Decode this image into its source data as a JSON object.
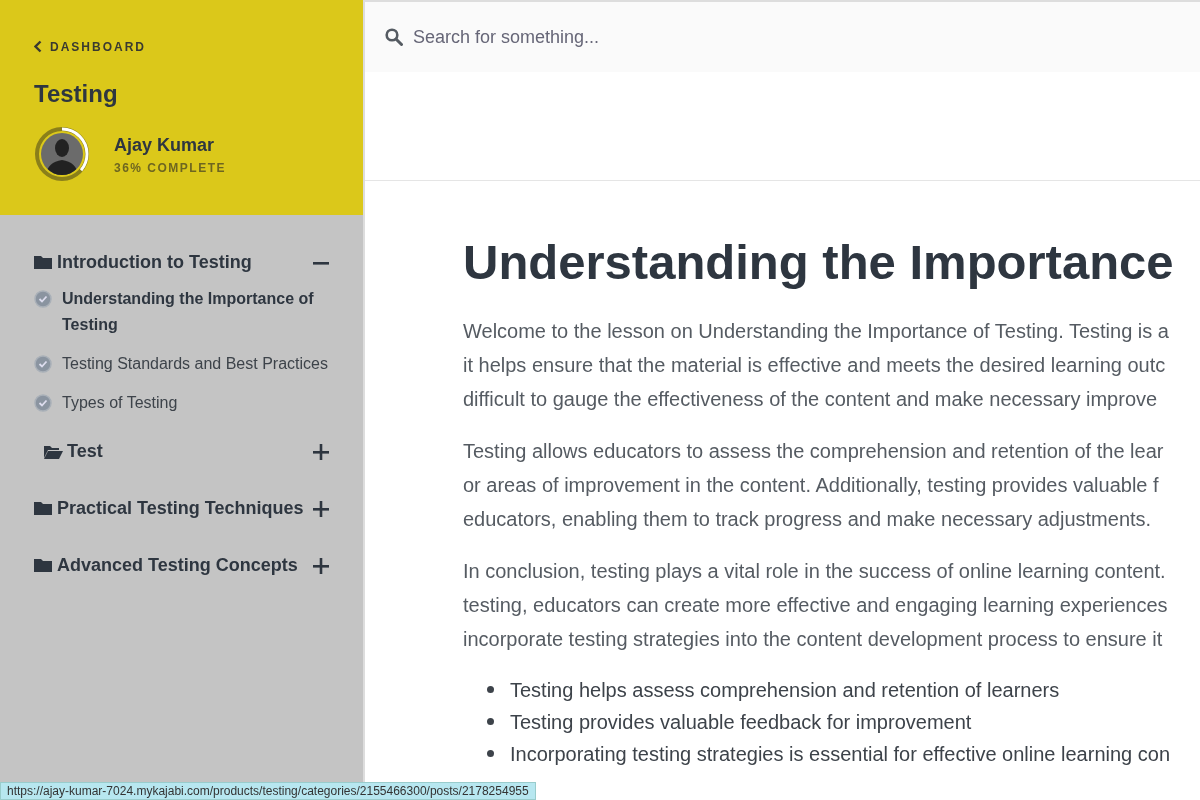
{
  "sidebar": {
    "back_link": "DASHBOARD",
    "course_title": "Testing",
    "user": {
      "name": "Ajay Kumar",
      "progress_text": "36% COMPLETE",
      "level": 0.36
    },
    "modules": [
      {
        "title": "Introduction to Testing",
        "expanded": true,
        "children": [
          {
            "kind": "lesson",
            "title": "Understanding the Importance of Testing",
            "selected": true
          },
          {
            "kind": "lesson",
            "title": "Testing Standards and Best Practices",
            "selected": false
          },
          {
            "kind": "lesson",
            "title": "Types of Testing",
            "selected": false
          },
          {
            "kind": "submodule",
            "title": "Test",
            "expanded": false
          }
        ]
      },
      {
        "title": "Practical Testing Techniques",
        "expanded": false
      },
      {
        "title": "Advanced Testing Concepts",
        "expanded": false
      }
    ]
  },
  "search": {
    "placeholder": "Search for something..."
  },
  "lesson": {
    "title": "Understanding the Importance",
    "paragraphs": [
      [
        "Welcome to the lesson on Understanding the Importance of Testing. Testing is a",
        "it helps ensure that the material is effective and meets the desired learning outc",
        "difficult to gauge the effectiveness of the content and make necessary improve"
      ],
      [
        "Testing allows educators to assess the comprehension and retention of the lear",
        "or areas of improvement in the content. Additionally, testing provides valuable f",
        "educators, enabling them to track progress and make necessary adjustments."
      ],
      [
        "In conclusion, testing plays a vital role in the success of online learning content.",
        "testing, educators can create more effective and engaging learning experiences",
        "incorporate testing strategies into the content development process to ensure it"
      ]
    ],
    "bullets": [
      "Testing helps assess comprehension and retention of learners",
      "Testing provides valuable feedback for improvement",
      "Incorporating testing strategies is essential for effective online learning con"
    ]
  },
  "status_url": "https://ajay-kumar-7024.mykajabi.com/products/testing/categories/2155466300/posts/2178254955"
}
